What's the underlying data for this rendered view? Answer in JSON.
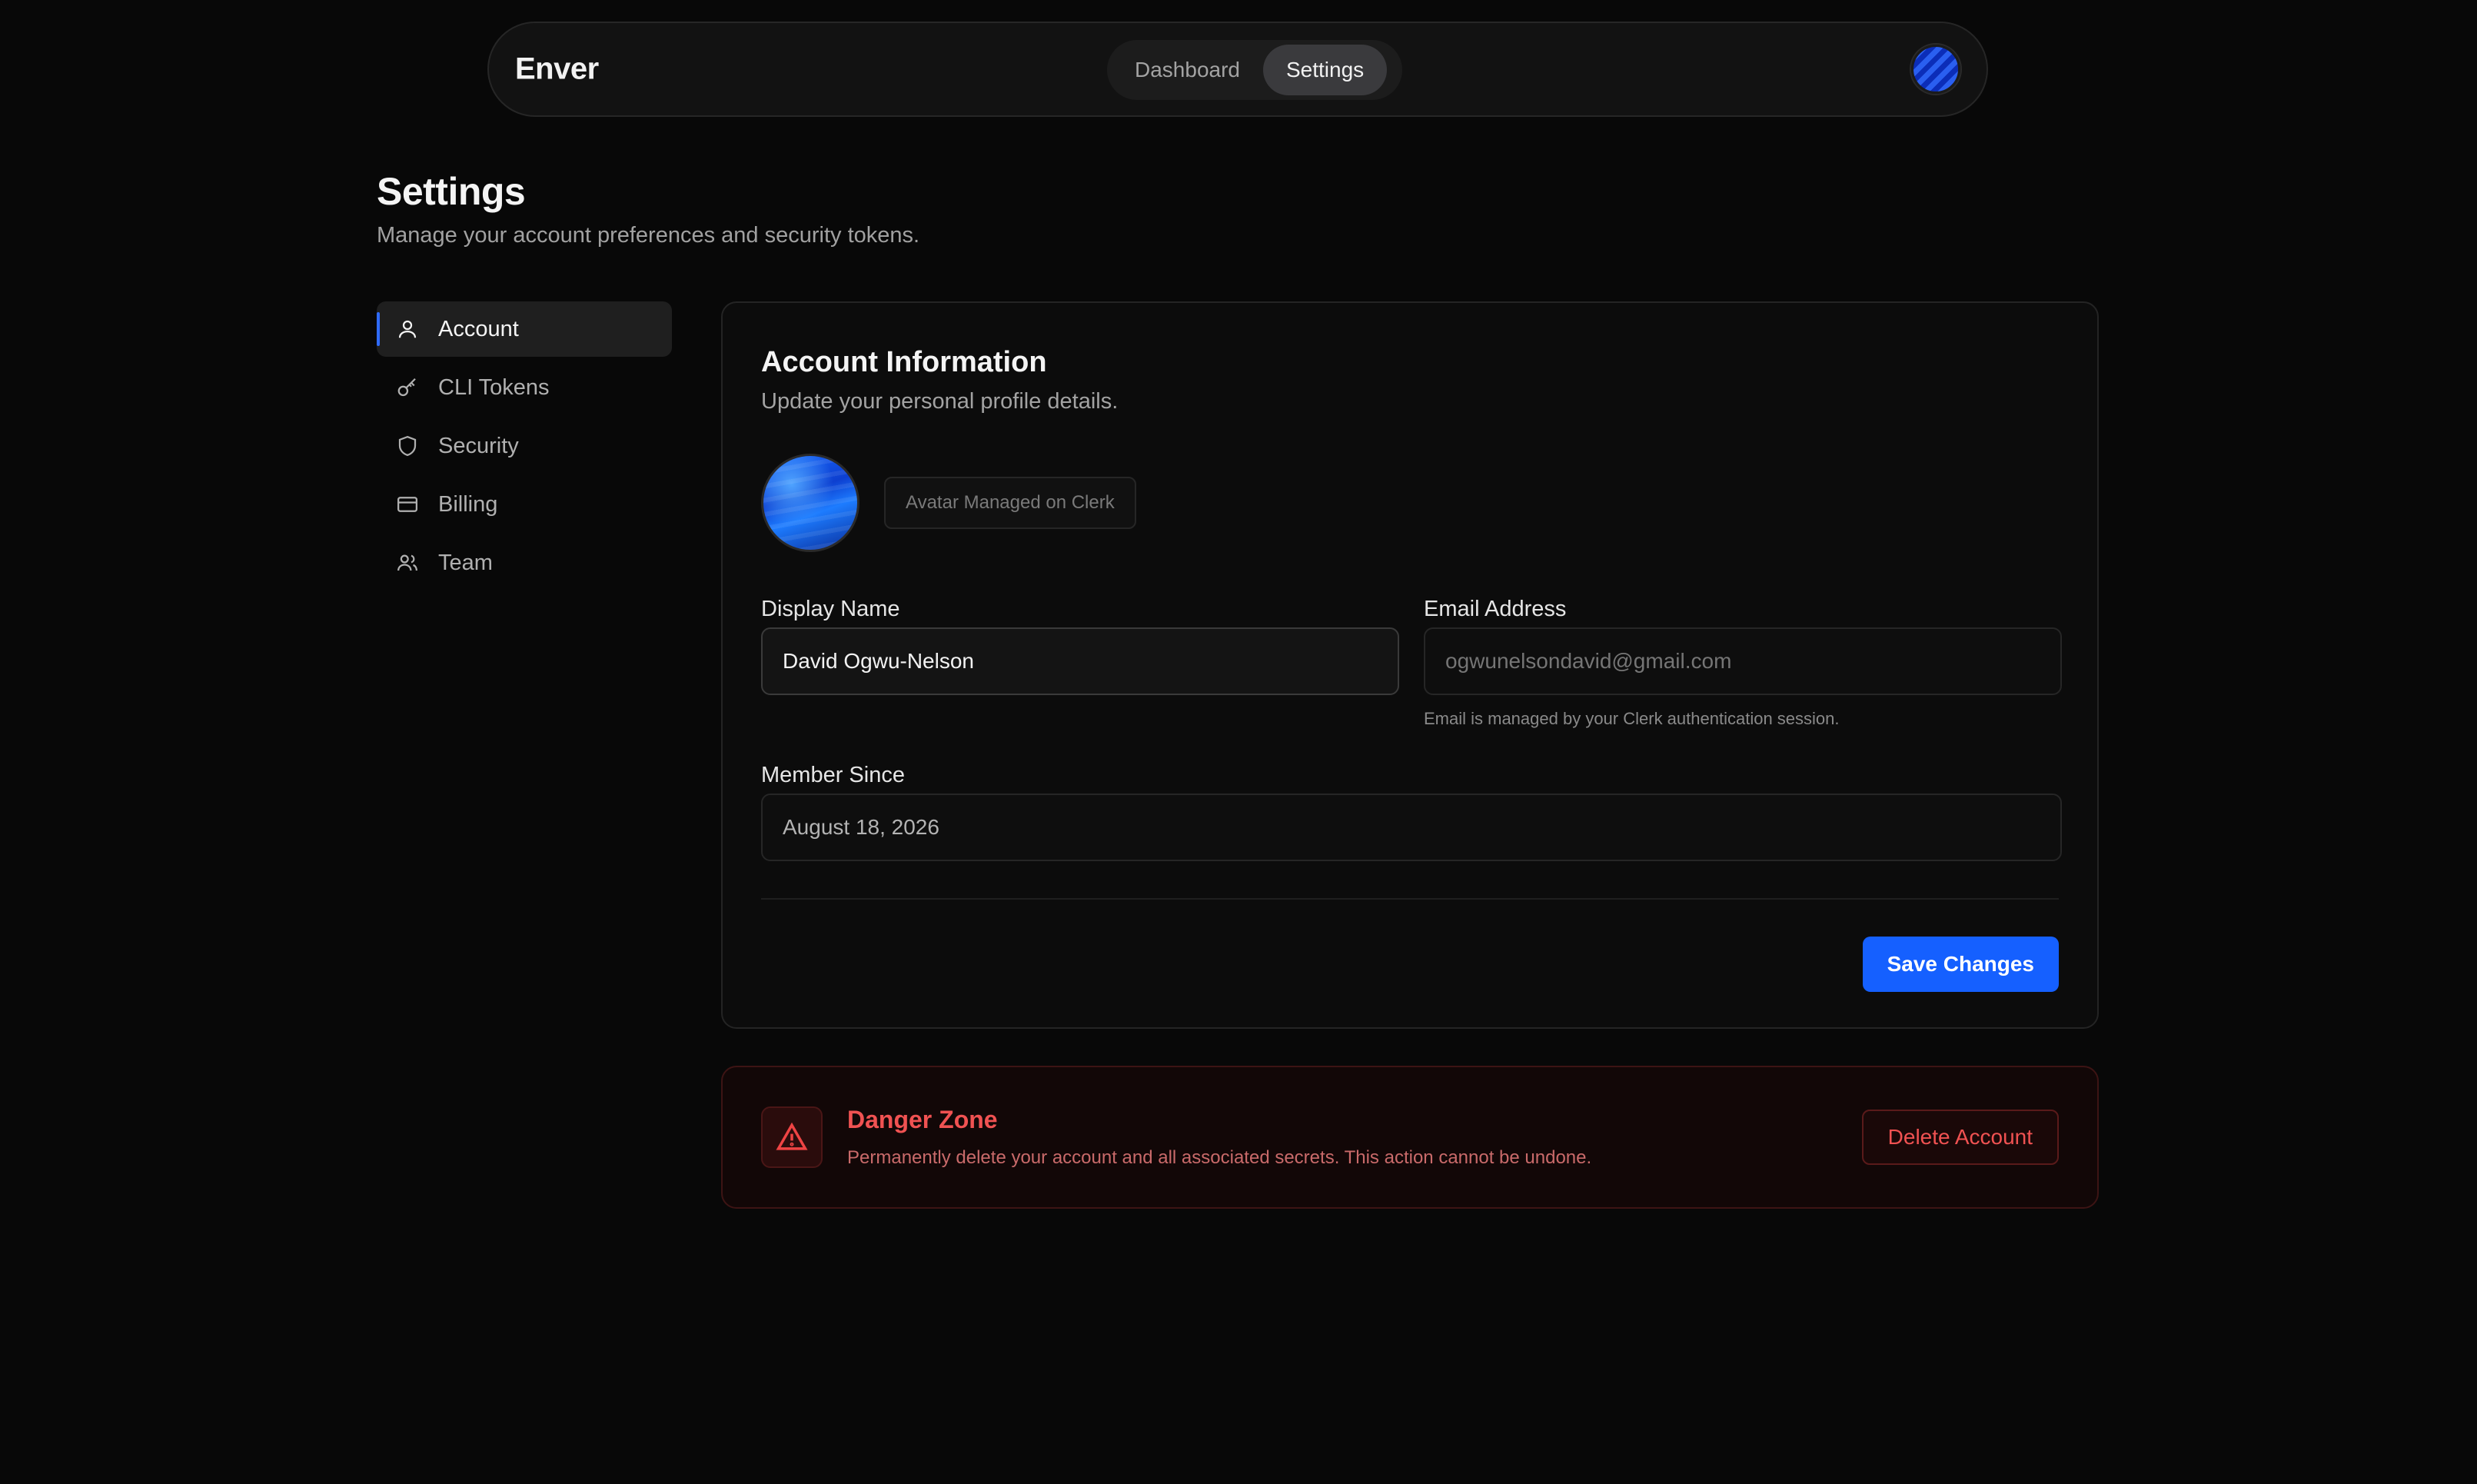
{
  "nav": {
    "brand": "Enver",
    "tabs": [
      {
        "label": "Dashboard",
        "active": false
      },
      {
        "label": "Settings",
        "active": true
      }
    ]
  },
  "header": {
    "title": "Settings",
    "subtitle": "Manage your account preferences and security tokens."
  },
  "sidebar": {
    "items": [
      {
        "label": "Account",
        "icon": "user-icon",
        "active": true
      },
      {
        "label": "CLI Tokens",
        "icon": "key-icon",
        "active": false
      },
      {
        "label": "Security",
        "icon": "shield-icon",
        "active": false
      },
      {
        "label": "Billing",
        "icon": "credit-card-icon",
        "active": false
      },
      {
        "label": "Team",
        "icon": "users-icon",
        "active": false
      }
    ]
  },
  "account": {
    "title": "Account Information",
    "subtitle": "Update your personal profile details.",
    "avatar_note": "Avatar Managed on Clerk",
    "display_name_label": "Display Name",
    "display_name_value": "David Ogwu-Nelson",
    "email_label": "Email Address",
    "email_placeholder": "ogwunelsondavid@gmail.com",
    "email_help": "Email is managed by your Clerk authentication session.",
    "member_since_label": "Member Since",
    "member_since_value": "August 18, 2026",
    "save_label": "Save Changes"
  },
  "danger": {
    "title": "Danger Zone",
    "description": "Permanently delete your account and all associated secrets. This action cannot be undone.",
    "delete_label": "Delete Account"
  },
  "colors": {
    "accent": "#1560ff",
    "danger": "#f05252",
    "background": "#080808"
  }
}
